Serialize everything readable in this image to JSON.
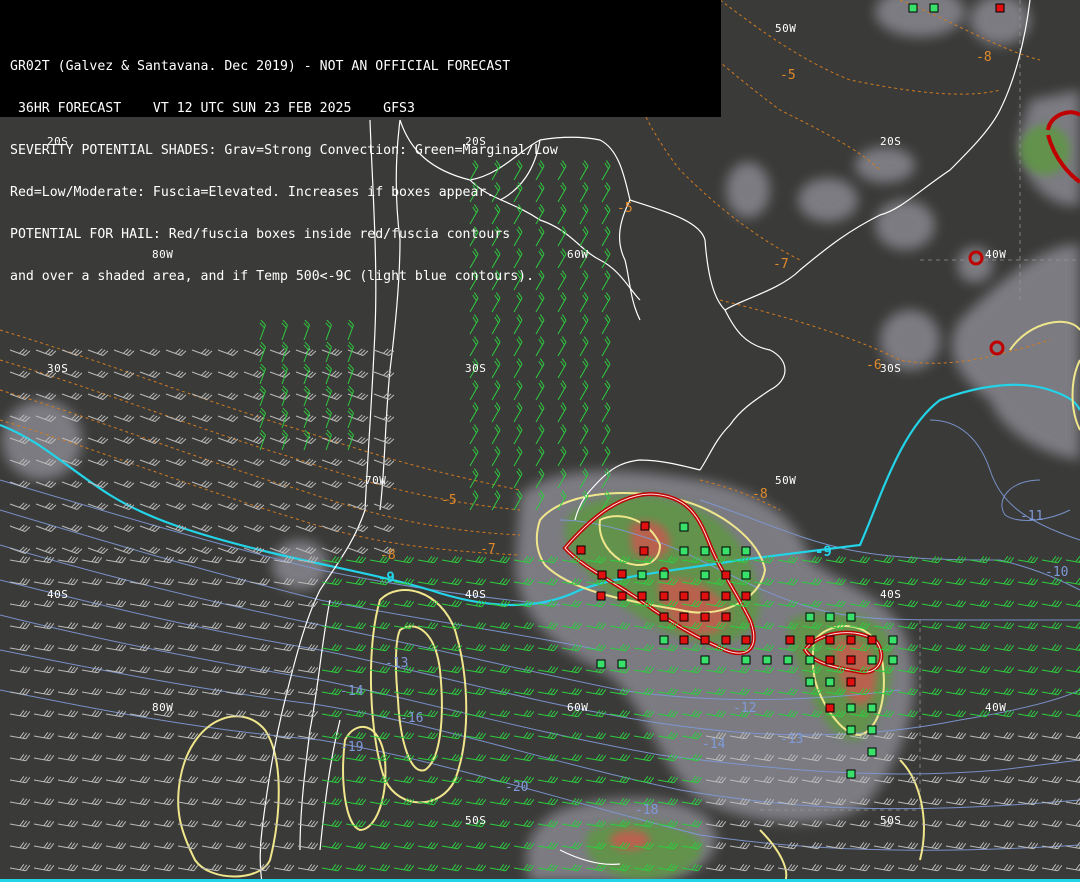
{
  "header": {
    "line1": "GR02T (Galvez & Santavana. Dec 2019) - NOT AN OFFICIAL FORECAST",
    "line2": " 36HR FORECAST    VT 12 UTC SUN 23 FEB 2025    GFS3",
    "line3": "SEVERITY POTENTIAL SHADES: Grav=Strong Convection: Green=Marginal/Low",
    "line4": "Red=Low/Moderate: Fuscia=Elevated. Increases if boxes appear.",
    "line5": "POTENTIAL FOR HAIL: Red/fuscia boxes inside red/fuscia contours",
    "line6": "and over a shaded area, and if Temp 500<-9C (light blue contours)."
  },
  "grid_labels": {
    "lat_20s_west": "20S",
    "lat_20s_mid": "20S",
    "lat_20s_east": "20S",
    "lat_30s_west": "30S",
    "lat_30s_mid": "30S",
    "lat_30s_east": "30S",
    "lat_40s_west": "40S",
    "lat_40s_mid": "40S",
    "lat_40s_east": "40S",
    "lat_50s_mid": "50S",
    "lat_50s_east": "50S",
    "lon_80w_north": "80W",
    "lon_70w_mid": "70W",
    "lon_60w_north": "60W",
    "lon_50w_top": "50W",
    "lon_50w_mid": "50W",
    "lon_40w_north": "40W",
    "lon_80w_south": "80W",
    "lon_60w_south": "60W",
    "lon_40w_south": "40W"
  },
  "contour_labels": {
    "t_m5_north": "-5",
    "t_m5_mid": "-5",
    "t_m5_south": "-5",
    "t_m7_mid": "-7",
    "t_m7_south": "-7",
    "t_m8_top": "-8",
    "t_m8_mid": "-8",
    "t_m8_south": "-8",
    "t_m6": "-6",
    "t_m9_west": "-9",
    "t_m9_east": "-9",
    "t_m10": "-10",
    "t_m11": "-11",
    "t_m12": "-12",
    "t_m13_w": "-13",
    "t_m13_e": "-13",
    "t_m14_w": "-14",
    "t_m14_e": "-14",
    "t_m16": "-16",
    "t_m18": "-18",
    "t_m19": "-19",
    "t_m20": "-20"
  },
  "colors": {
    "background": "#3a3a38",
    "strong_convection_gray": "#8a8a90",
    "marginal_green": "#5a9a3a",
    "low_moderate_red": "#c85a50",
    "hail_contour": "#c00000",
    "temp500_contour": "#23d3e8",
    "temp_lines_blue": "#7f9ad8",
    "orange_isotherms": "#d07a20",
    "yellow_contours": "#f0e68c",
    "coastline": "#ffffff",
    "wind_barbs_green": "#2ecc40",
    "wind_barbs_gray": "#bbbbbb"
  },
  "legend_markers": [
    "hail-box-red",
    "convection-box-green"
  ]
}
